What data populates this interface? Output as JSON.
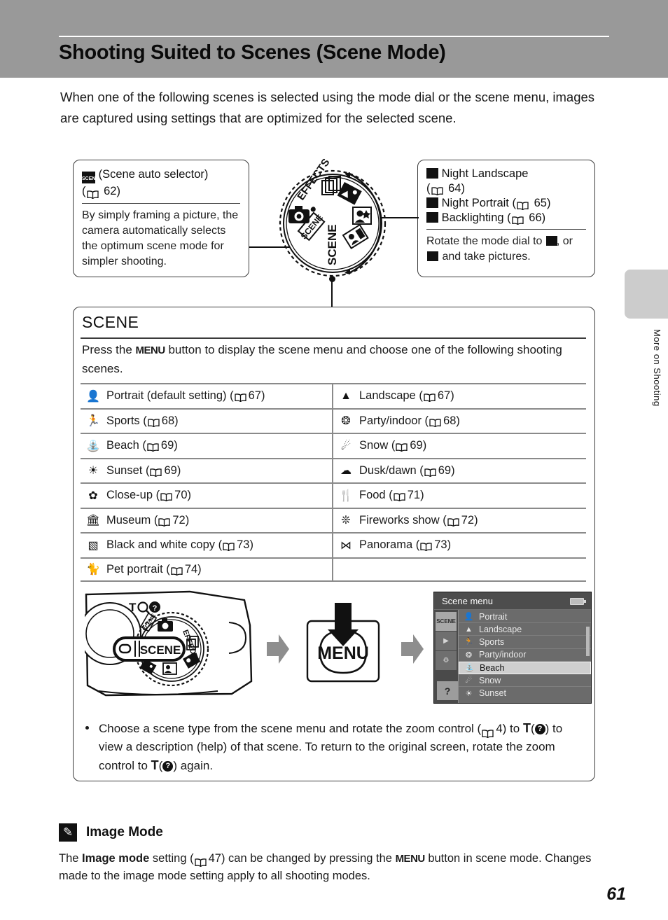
{
  "header": {
    "title": "Shooting Suited to Scenes (Scene Mode)"
  },
  "side_tab": {
    "label": "More on Shooting"
  },
  "intro": "When one of the following scenes is selected using the mode dial or the scene menu, images are captured using settings that are optimized for the selected scene.",
  "callout_left": {
    "icon": "scene-auto-selector-icon",
    "heading": "(Scene auto selector)",
    "page_ref": "62",
    "body": "By simply framing a picture, the camera automatically selects the optimum scene mode for simpler shooting."
  },
  "callout_right": {
    "items": [
      {
        "icon": "night-landscape-icon",
        "label": "Night Landscape",
        "page_ref": "64"
      },
      {
        "icon": "night-portrait-icon",
        "label": "Night Portrait",
        "page_ref": "65"
      },
      {
        "icon": "backlighting-icon",
        "label": "Backlighting",
        "page_ref": "66"
      }
    ],
    "body_prefix": "Rotate the mode dial to",
    "body_suffix": "and take pictures.",
    "body_mid": ", or"
  },
  "mode_dial": {
    "labels": [
      "EFFECTS",
      "SCENE",
      "SCENE"
    ],
    "icons": [
      "camera-auto-icon",
      "scene-auto-selector-icon",
      "multiple-frames-icon",
      "night-landscape-icon",
      "night-portrait-icon",
      "backlighting-icon"
    ]
  },
  "scene_panel": {
    "title": "SCENE",
    "intro_before": "Press the",
    "intro_menu": "MENU",
    "intro_after": "button to display the scene menu and choose one of the following shooting scenes.",
    "rows": [
      [
        {
          "icon": "portrait-icon",
          "label": "Portrait (default setting)",
          "page_ref": "67"
        },
        {
          "icon": "landscape-icon",
          "label": "Landscape",
          "page_ref": "67"
        }
      ],
      [
        {
          "icon": "sports-icon",
          "label": "Sports",
          "page_ref": "68"
        },
        {
          "icon": "party-indoor-icon",
          "label": "Party/indoor",
          "page_ref": "68"
        }
      ],
      [
        {
          "icon": "beach-icon",
          "label": "Beach",
          "page_ref": "69"
        },
        {
          "icon": "snow-icon",
          "label": "Snow",
          "page_ref": "69"
        }
      ],
      [
        {
          "icon": "sunset-icon",
          "label": "Sunset",
          "page_ref": "69"
        },
        {
          "icon": "dusk-dawn-icon",
          "label": "Dusk/dawn",
          "page_ref": "69"
        }
      ],
      [
        {
          "icon": "close-up-icon",
          "label": "Close-up",
          "page_ref": "70"
        },
        {
          "icon": "food-icon",
          "label": "Food",
          "page_ref": "71"
        }
      ],
      [
        {
          "icon": "museum-icon",
          "label": "Museum",
          "page_ref": "72"
        },
        {
          "icon": "fireworks-icon",
          "label": "Fireworks show",
          "page_ref": "72"
        }
      ],
      [
        {
          "icon": "bw-copy-icon",
          "label": "Black and white copy",
          "page_ref": "73"
        },
        {
          "icon": "panorama-icon",
          "label": "Panorama",
          "page_ref": "73"
        }
      ],
      [
        {
          "icon": "pet-portrait-icon",
          "label": "Pet portrait",
          "page_ref": "74"
        },
        {
          "icon": "",
          "label": "",
          "page_ref": ""
        }
      ]
    ],
    "bullet": {
      "part1": "Choose a scene type from the scene menu and rotate the zoom control (",
      "zoom_ref": "4",
      "part2": ") to",
      "t_label": "T",
      "part3": ") to view a description (help) of that scene. To return to the original screen, rotate the zoom control to",
      "part4": ") again."
    }
  },
  "camera_art": {
    "zoom_labels": [
      "T",
      "Q",
      "?"
    ],
    "dial_label_selected": "SCENE",
    "dial_labels": [
      "EFFECTS",
      "SCENE"
    ]
  },
  "menu_button_art": {
    "label": "MENU"
  },
  "lcd": {
    "title": "Scene menu",
    "battery_icon": "battery-icon",
    "tabs": [
      {
        "name": "scene-tab",
        "glyph": "SCENE",
        "selected": true
      },
      {
        "name": "movie-tab",
        "glyph": "▶",
        "selected": false
      },
      {
        "name": "setup-tab",
        "glyph": "⚙",
        "selected": false
      },
      {
        "name": "help-tab",
        "glyph": "?",
        "selected": false
      }
    ],
    "items": [
      {
        "icon": "portrait-icon",
        "label": "Portrait",
        "selected": false
      },
      {
        "icon": "landscape-icon",
        "label": "Landscape",
        "selected": false
      },
      {
        "icon": "sports-icon",
        "label": "Sports",
        "selected": false
      },
      {
        "icon": "party-indoor-icon",
        "label": "Party/indoor",
        "selected": false
      },
      {
        "icon": "beach-icon",
        "label": "Beach",
        "selected": true
      },
      {
        "icon": "snow-icon",
        "label": "Snow",
        "selected": false
      },
      {
        "icon": "sunset-icon",
        "label": "Sunset",
        "selected": false
      }
    ]
  },
  "note": {
    "icon": "pencil-icon",
    "title": "Image Mode",
    "body_part1": "The",
    "body_bold": "Image mode",
    "body_part2": "setting (",
    "page_ref": "47",
    "body_part3": ") can be changed by pressing the",
    "menu_label": "MENU",
    "body_part4": "button in scene mode. Changes made to the image mode setting apply to all shooting modes."
  },
  "page_number": "61"
}
